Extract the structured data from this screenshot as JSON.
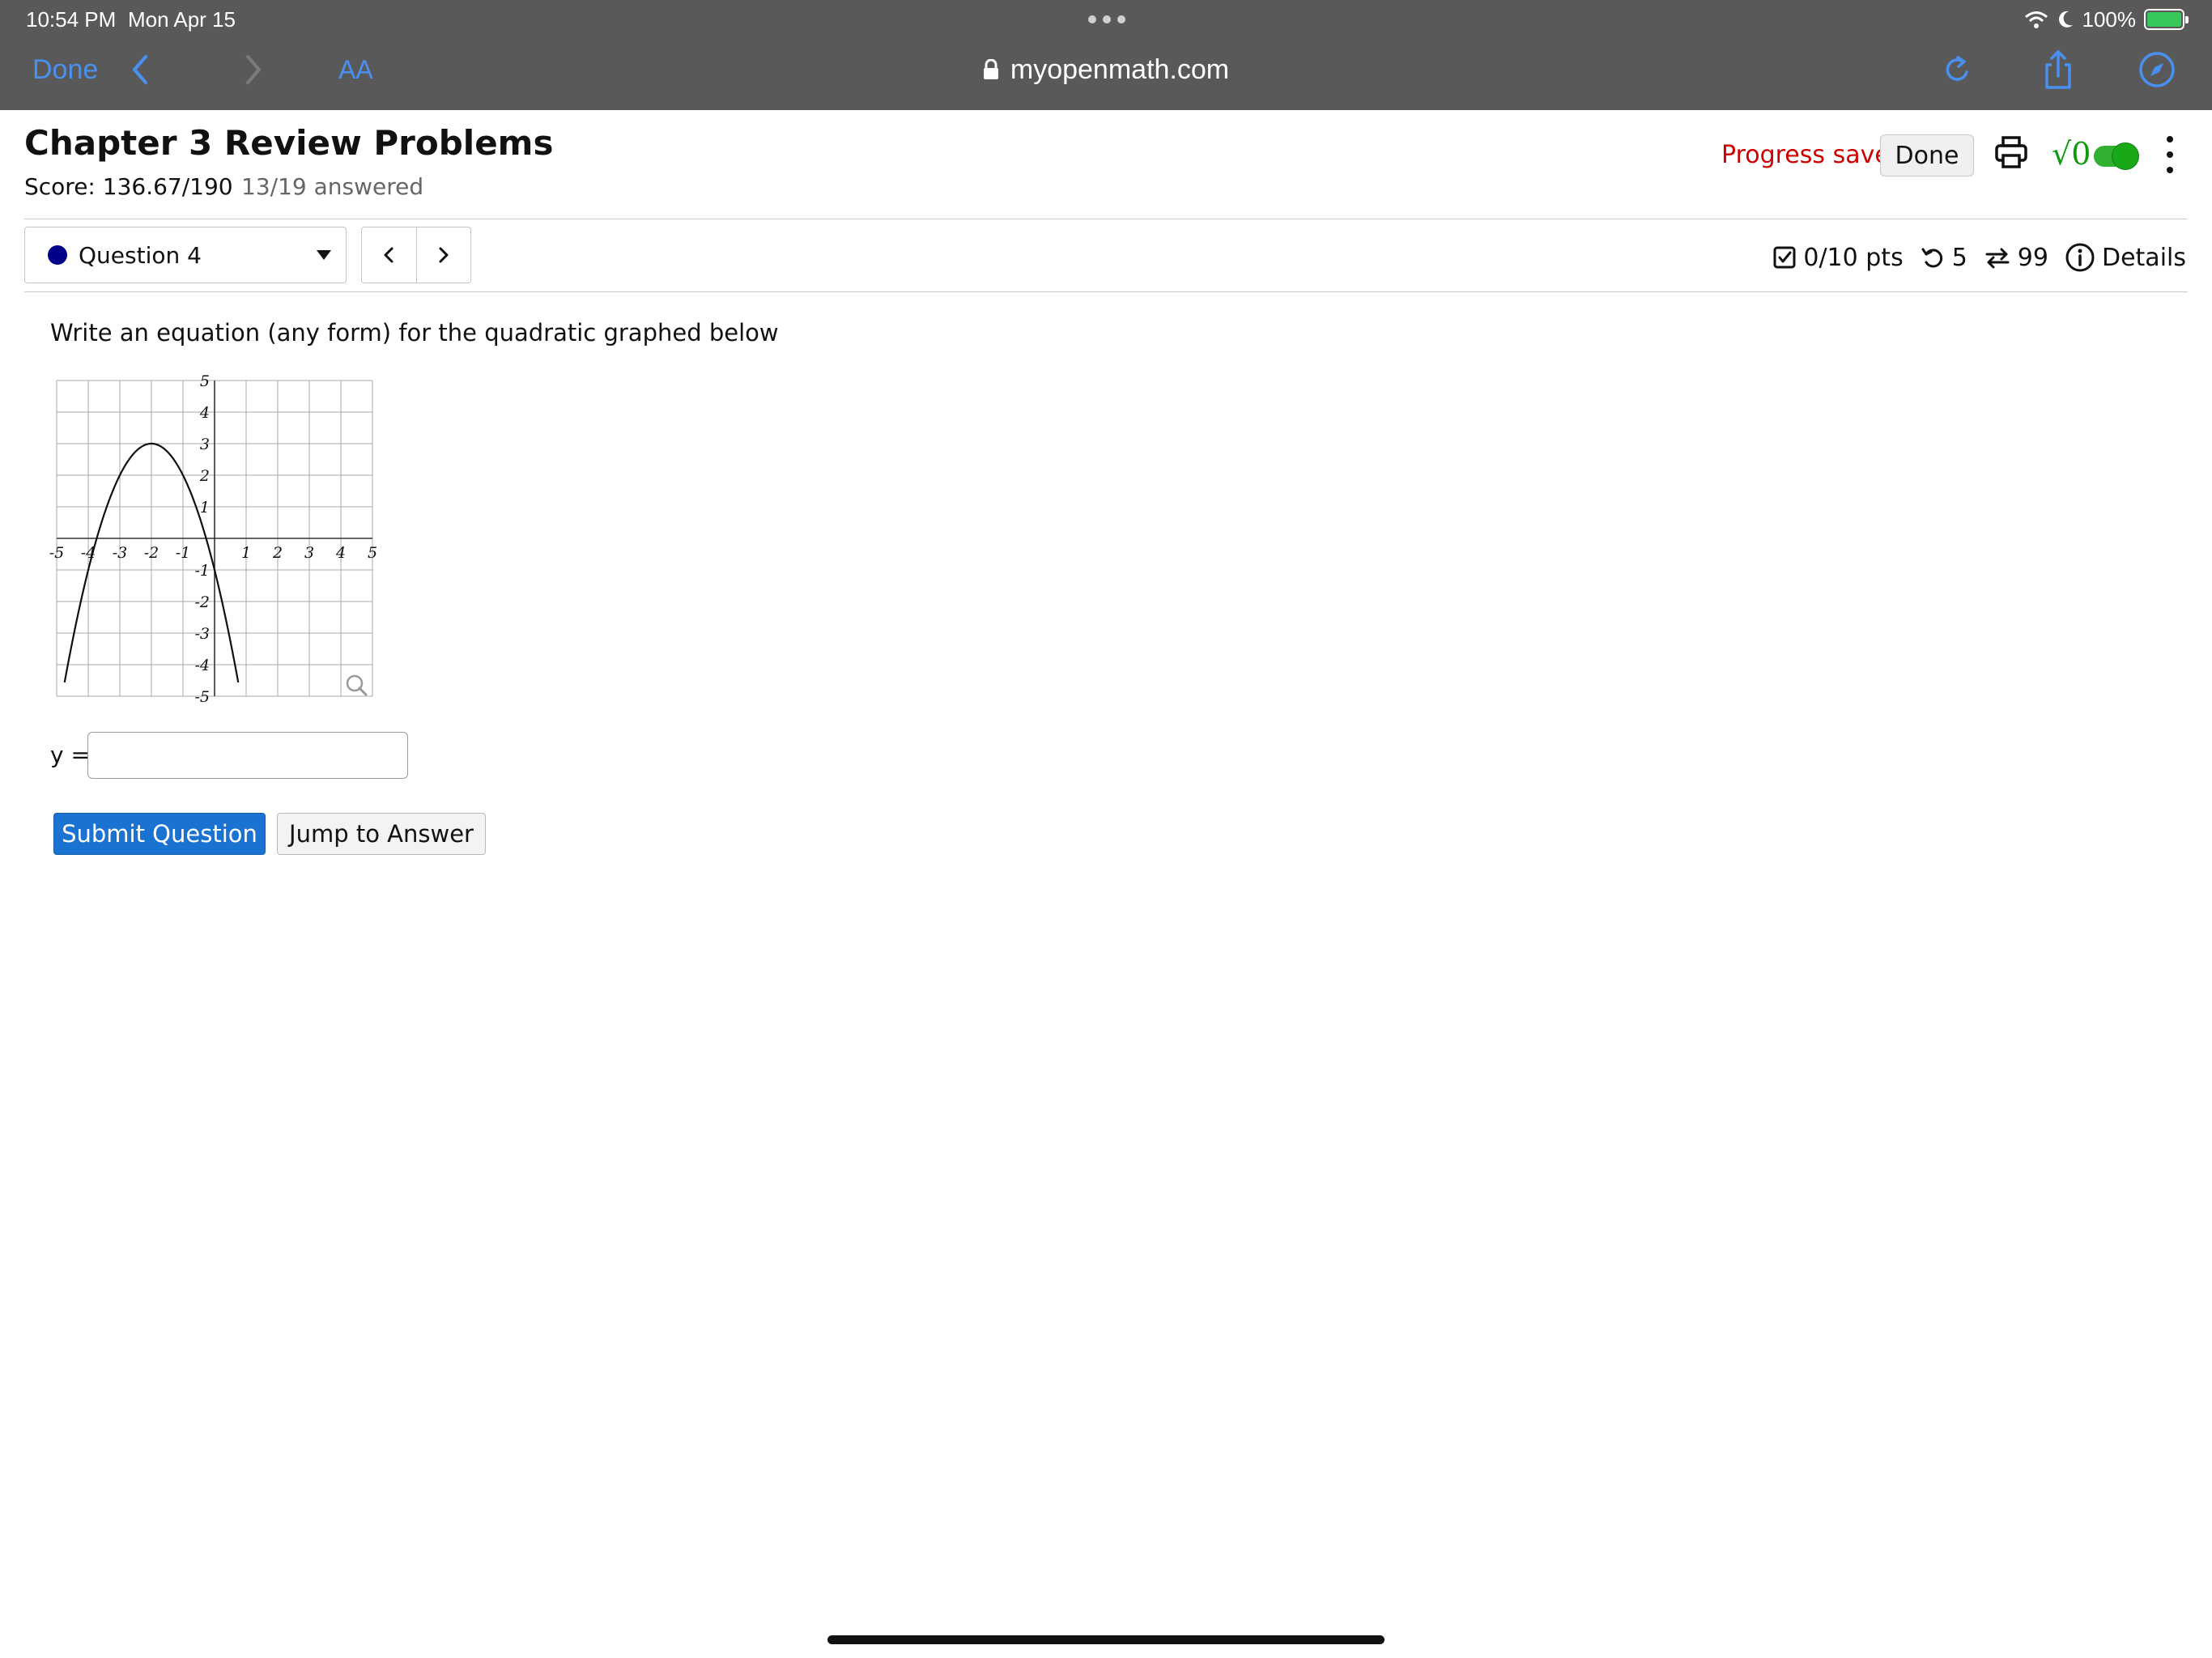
{
  "status_bar": {
    "time": "10:54 PM",
    "date": "Mon Apr 15",
    "battery": "100%"
  },
  "browser": {
    "done_label": "Done",
    "text_size_label": "AA",
    "url": "myopenmath.com"
  },
  "header": {
    "title": "Chapter 3 Review Problems",
    "score": "Score: 136.67/190",
    "answered": "13/19 answered",
    "progress_status": "Progress saved",
    "done_label": "Done"
  },
  "question_nav": {
    "selected": "Question 4",
    "points": "0/10 pts",
    "retries": "5",
    "versions": "99",
    "details_label": "Details"
  },
  "question": {
    "prompt": "Write an equation (any form) for the quadratic graphed below",
    "answer_label": "y =",
    "answer_value": "",
    "submit_label": "Submit Question",
    "jump_label": "Jump to Answer"
  },
  "chart_data": {
    "type": "line",
    "title": "",
    "xlabel": "",
    "ylabel": "",
    "xlim": [
      -5,
      5
    ],
    "ylim": [
      -5,
      5
    ],
    "grid": true,
    "x_ticks": [
      "-5",
      "-4",
      "-3",
      "-2",
      "-1",
      "1",
      "2",
      "3",
      "4",
      "5"
    ],
    "y_ticks": [
      "5",
      "4",
      "3",
      "2",
      "1",
      "-1",
      "-2",
      "-3",
      "-4",
      "-5"
    ],
    "series": [
      {
        "x": [
          -4.75,
          -4.5,
          -4,
          -3.5,
          -3,
          -2.5,
          -2,
          -1.5,
          -1,
          -0.5,
          0,
          0.5,
          0.75
        ],
        "y": [
          -5.06,
          -3.25,
          0,
          2.25,
          2.25,
          2.75,
          3,
          2.75,
          2,
          0.75,
          -1,
          -3.25,
          -4.56
        ]
      }
    ]
  },
  "colors": {
    "chrome": "#595959",
    "chrome_accent": "#4a90f0",
    "progress_saved": "#cc0000",
    "submit_button": "#1a73d0",
    "toggle_on": "#31b031",
    "question_dot": "#00008b"
  }
}
